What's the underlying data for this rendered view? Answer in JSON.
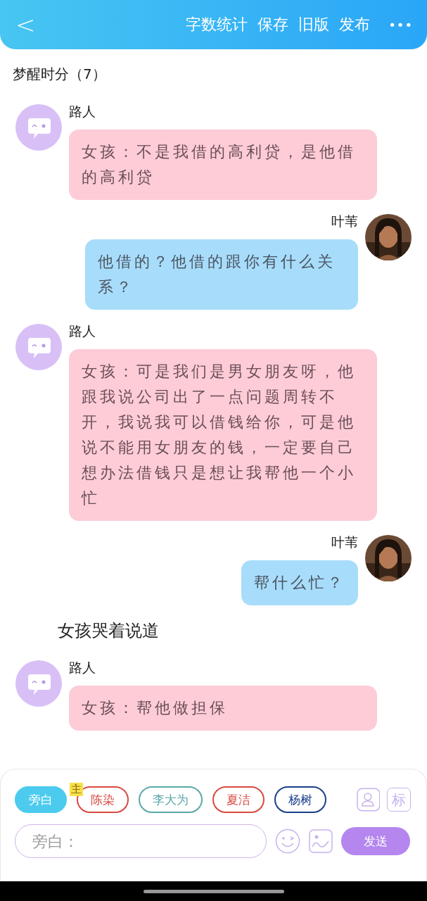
{
  "header": {
    "back": "<",
    "actions": [
      "字数统计",
      "保存",
      "旧版",
      "发布"
    ],
    "more": "•••"
  },
  "title": "梦醒时分（7）",
  "messages": [
    {
      "kind": "left",
      "name": "路人",
      "text": "女孩：不是我借的高利贷，是他借的高利贷"
    },
    {
      "kind": "right",
      "name": "叶苇",
      "text": "他借的？他借的跟你有什么关系？"
    },
    {
      "kind": "left",
      "name": "路人",
      "text": "女孩：可是我们是男女朋友呀，他跟我说公司出了一点问题周转不开，我说我可以借钱给你，可是他说不能用女朋友的钱，一定要自己想办法借钱只是想让我帮他一个小忙"
    },
    {
      "kind": "right",
      "name": "叶苇",
      "text": "帮什么忙？"
    },
    {
      "kind": "narration",
      "text": "女孩哭着说道"
    },
    {
      "kind": "left",
      "name": "路人",
      "text": "女孩：帮他做担保"
    }
  ],
  "roles": [
    {
      "label": "旁白",
      "selected": true,
      "color": "#4ccbef"
    },
    {
      "label": "陈染",
      "selected": false,
      "color": "#d9493f",
      "badge": "主"
    },
    {
      "label": "李大为",
      "selected": false,
      "color": "#5aa8a8"
    },
    {
      "label": "夏洁",
      "selected": false,
      "color": "#d9493f"
    },
    {
      "label": "杨树",
      "selected": false,
      "color": "#1a3f8a"
    }
  ],
  "role_icon_label": "标",
  "input": {
    "placeholder": "旁白："
  },
  "send": "发送"
}
